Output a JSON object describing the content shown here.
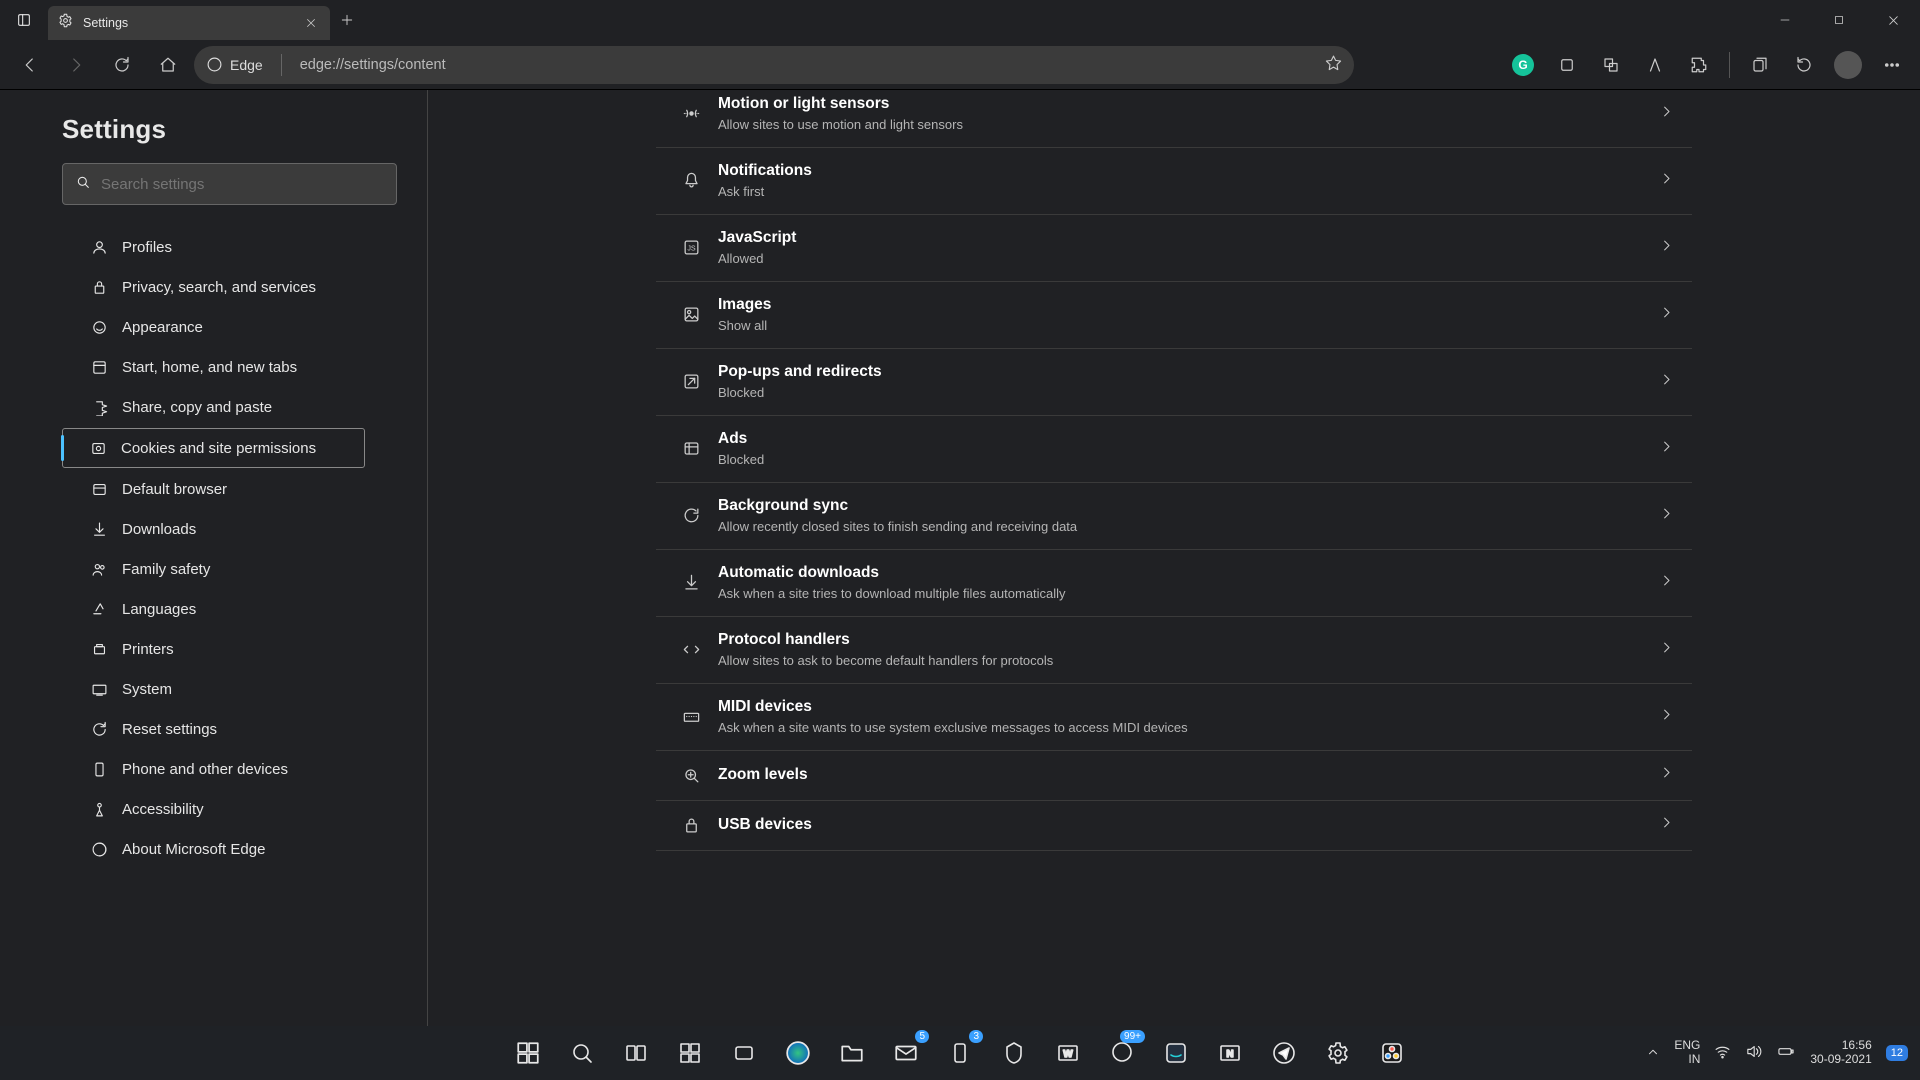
{
  "tab": {
    "title": "Settings"
  },
  "address": {
    "chip": "Edge",
    "url": "edge://settings/content"
  },
  "sidebar": {
    "title": "Settings",
    "search_placeholder": "Search settings",
    "items": [
      {
        "label": "Profiles"
      },
      {
        "label": "Privacy, search, and services"
      },
      {
        "label": "Appearance"
      },
      {
        "label": "Start, home, and new tabs"
      },
      {
        "label": "Share, copy and paste"
      },
      {
        "label": "Cookies and site permissions"
      },
      {
        "label": "Default browser"
      },
      {
        "label": "Downloads"
      },
      {
        "label": "Family safety"
      },
      {
        "label": "Languages"
      },
      {
        "label": "Printers"
      },
      {
        "label": "System"
      },
      {
        "label": "Reset settings"
      },
      {
        "label": "Phone and other devices"
      },
      {
        "label": "Accessibility"
      },
      {
        "label": "About Microsoft Edge"
      }
    ],
    "active_index": 5
  },
  "permissions": [
    {
      "title": "Motion or light sensors",
      "sub": "Allow sites to use motion and light sensors"
    },
    {
      "title": "Notifications",
      "sub": "Ask first"
    },
    {
      "title": "JavaScript",
      "sub": "Allowed"
    },
    {
      "title": "Images",
      "sub": "Show all"
    },
    {
      "title": "Pop-ups and redirects",
      "sub": "Blocked"
    },
    {
      "title": "Ads",
      "sub": "Blocked"
    },
    {
      "title": "Background sync",
      "sub": "Allow recently closed sites to finish sending and receiving data"
    },
    {
      "title": "Automatic downloads",
      "sub": "Ask when a site tries to download multiple files automatically"
    },
    {
      "title": "Protocol handlers",
      "sub": "Allow sites to ask to become default handlers for protocols"
    },
    {
      "title": "MIDI devices",
      "sub": "Ask when a site wants to use system exclusive messages to access MIDI devices"
    },
    {
      "title": "Zoom levels",
      "sub": ""
    },
    {
      "title": "USB devices",
      "sub": ""
    }
  ],
  "taskbar": {
    "badges": {
      "mail": "5",
      "phonelink": "3",
      "messenger": "99+"
    },
    "lang1": "ENG",
    "lang2": "IN",
    "time": "16:56",
    "date": "30-09-2021",
    "notif_count": "12"
  }
}
